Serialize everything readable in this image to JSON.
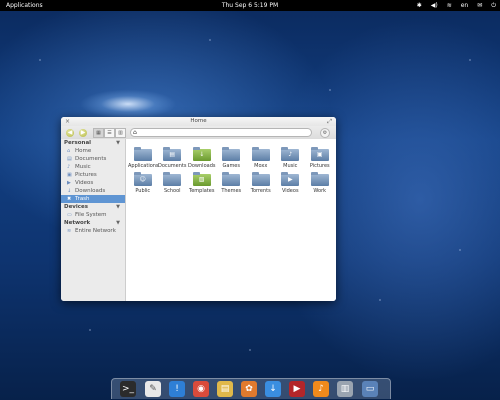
{
  "panel": {
    "applications": "Applications",
    "clock": "Thu Sep  6  5:19 PM",
    "indicators": {
      "bluetooth": "✱",
      "volume": "◀)",
      "network": "≋",
      "language": "en",
      "mail": "✉",
      "power": "⏻"
    }
  },
  "window": {
    "title": "Home",
    "toolbar": {
      "back": "◀",
      "forward": "▶",
      "view_icons": "▦",
      "view_list": "☰",
      "view_columns": "▥",
      "path_home": "⌂",
      "settings": "⚙"
    },
    "close": "×",
    "maximize": "⤢"
  },
  "sidebar": {
    "personal": {
      "label": "Personal",
      "items": [
        {
          "label": "Home",
          "icon": "⌂"
        },
        {
          "label": "Documents",
          "icon": "▤"
        },
        {
          "label": "Music",
          "icon": "♪"
        },
        {
          "label": "Pictures",
          "icon": "▣"
        },
        {
          "label": "Videos",
          "icon": "▶"
        },
        {
          "label": "Downloads",
          "icon": "↓"
        },
        {
          "label": "Trash",
          "icon": "✖"
        }
      ]
    },
    "devices": {
      "label": "Devices",
      "items": [
        {
          "label": "File System",
          "icon": "▭"
        }
      ]
    },
    "network": {
      "label": "Network",
      "items": [
        {
          "label": "Entire Network",
          "icon": "≋"
        }
      ]
    }
  },
  "files": [
    {
      "name": "Applications",
      "icon": ""
    },
    {
      "name": "Documents",
      "icon": "▤"
    },
    {
      "name": "Downloads",
      "icon": "↓"
    },
    {
      "name": "Games",
      "icon": ""
    },
    {
      "name": "Moxx",
      "icon": ""
    },
    {
      "name": "Music",
      "icon": "♪"
    },
    {
      "name": "Pictures",
      "icon": "▣"
    },
    {
      "name": "Public",
      "icon": "☺"
    },
    {
      "name": "School",
      "icon": ""
    },
    {
      "name": "Templates",
      "icon": "▧"
    },
    {
      "name": "Themes",
      "icon": ""
    },
    {
      "name": "Torrents",
      "icon": ""
    },
    {
      "name": "Videos",
      "icon": "▶"
    },
    {
      "name": "Work",
      "icon": ""
    }
  ],
  "dock": [
    {
      "name": "terminal-icon",
      "glyph": ">_",
      "color": "#2b2b2b"
    },
    {
      "name": "text-editor-icon",
      "glyph": "✎",
      "color": "#e8e8e8"
    },
    {
      "name": "chat-icon",
      "glyph": "!",
      "color": "#2e7fd6"
    },
    {
      "name": "chromium-icon",
      "glyph": "◉",
      "color": "#d94b3b"
    },
    {
      "name": "notes-icon",
      "glyph": "▤",
      "color": "#e0b84a"
    },
    {
      "name": "shotwell-icon",
      "glyph": "✿",
      "color": "#e07a2e"
    },
    {
      "name": "download-icon",
      "glyph": "↓",
      "color": "#3a8ee0"
    },
    {
      "name": "video-icon",
      "glyph": "▶",
      "color": "#b3262a"
    },
    {
      "name": "music-icon",
      "glyph": "♪",
      "color": "#f08a1c"
    },
    {
      "name": "system-monitor-icon",
      "glyph": "▥",
      "color": "#9aa4b0"
    },
    {
      "name": "files-icon",
      "glyph": "▭",
      "color": "#5a82b8"
    }
  ]
}
